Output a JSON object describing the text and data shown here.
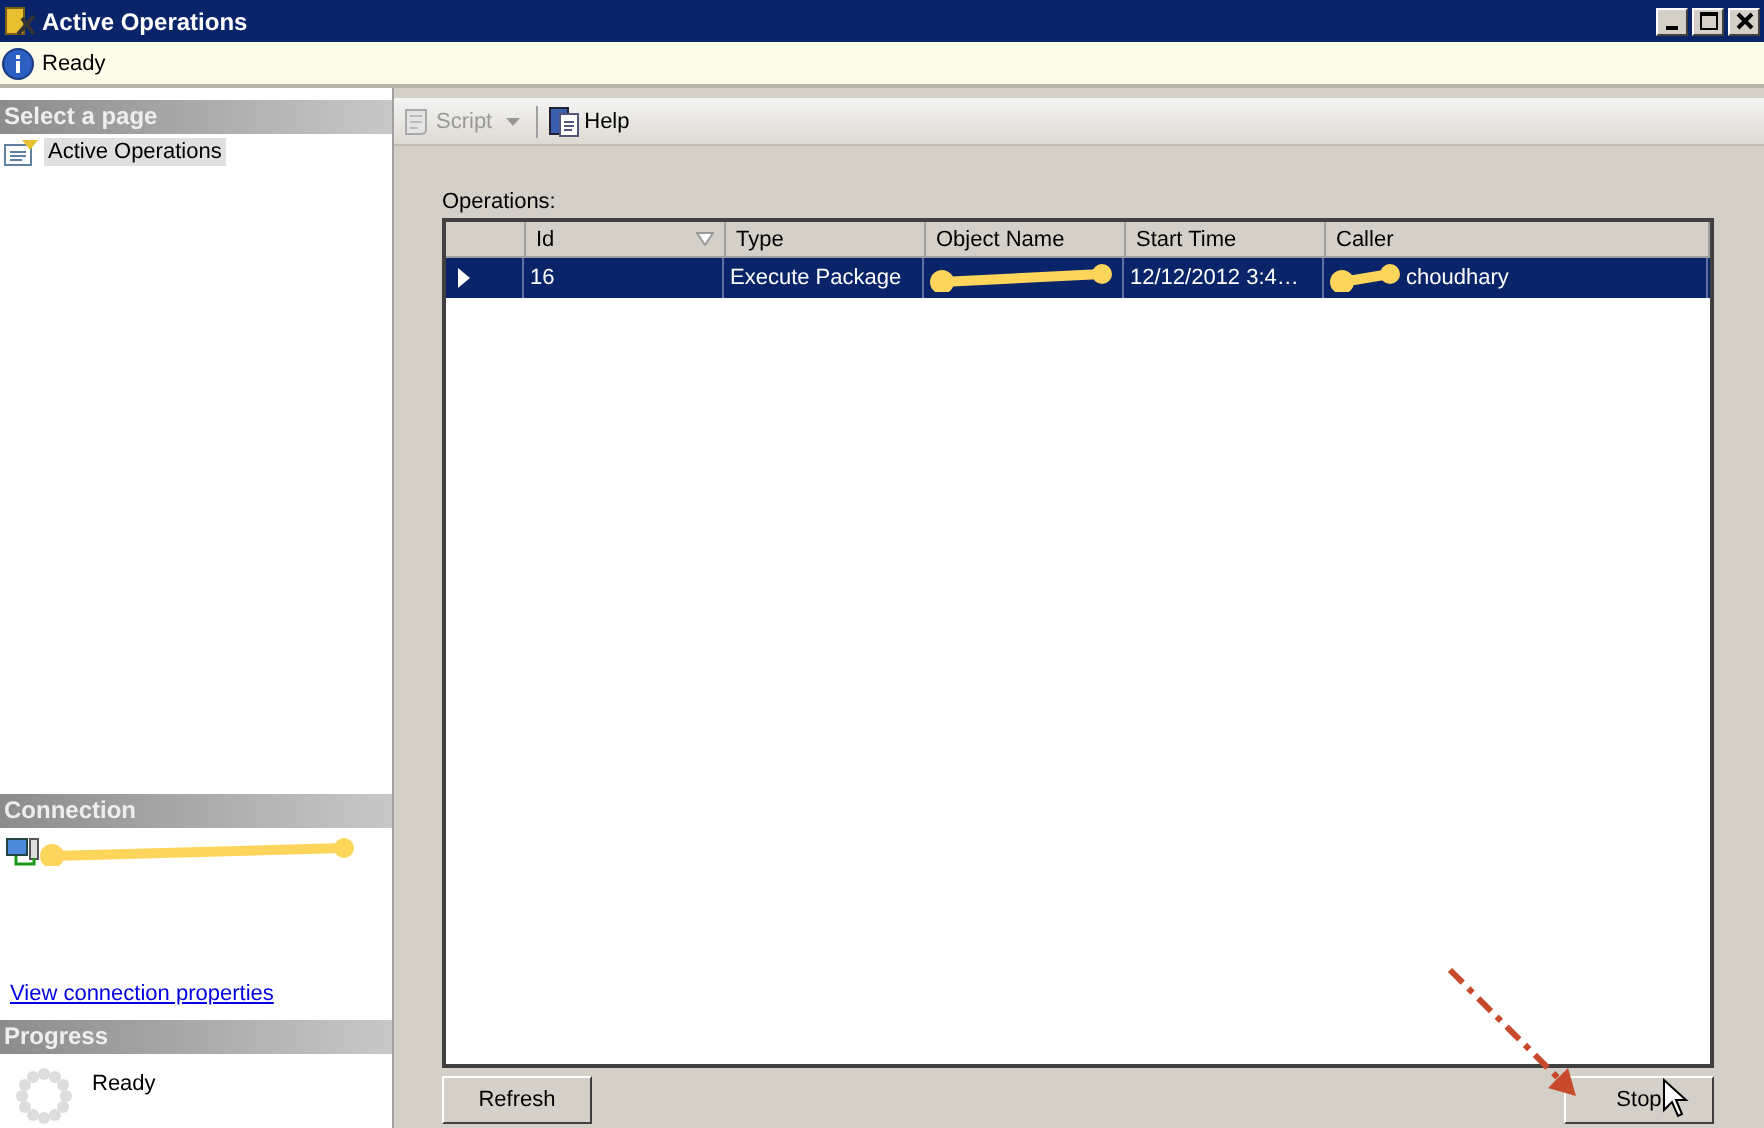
{
  "window": {
    "title": "Active Operations"
  },
  "status": {
    "text": "Ready"
  },
  "sidebar": {
    "select_header": "Select a page",
    "pages": [
      {
        "label": "Active Operations",
        "selected": true
      }
    ],
    "connection_header": "Connection",
    "connection": {
      "redacted": true
    },
    "connection_link": "View connection properties",
    "progress_header": "Progress",
    "progress_status": "Ready"
  },
  "toolbar": [
    {
      "label": "Script",
      "disabled": true,
      "dropdown": true
    },
    {
      "label": "Help",
      "disabled": false,
      "dropdown": false
    }
  ],
  "operations": {
    "label": "Operations:",
    "columns": [
      {
        "label": "Id",
        "sorted": true
      },
      {
        "label": "Type",
        "sorted": false
      },
      {
        "label": "Object Name",
        "sorted": false
      },
      {
        "label": "Start Time",
        "sorted": false
      },
      {
        "label": "Caller",
        "sorted": false
      }
    ],
    "rows": [
      {
        "selected": true,
        "cells": [
          {
            "text": "16"
          },
          {
            "text": "Execute Package"
          },
          {
            "redacted": true
          },
          {
            "text": "12/12/2012 3:4…"
          },
          {
            "text": "choudhary",
            "redacted": true
          }
        ]
      }
    ]
  },
  "buttons": [
    {
      "label": "Refresh"
    },
    {
      "label": "Stop"
    }
  ]
}
